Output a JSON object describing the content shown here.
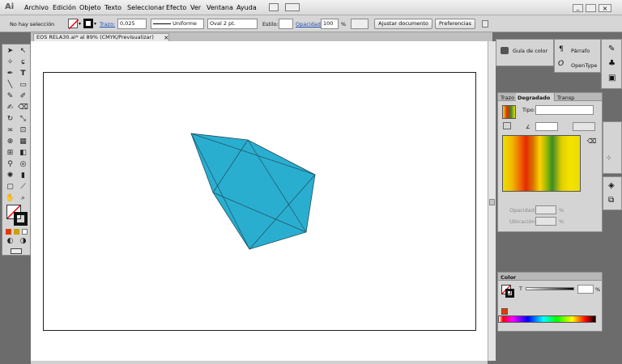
{
  "app": {
    "logo": "Ai"
  },
  "menu": [
    "Archivo",
    "Edición",
    "Objeto",
    "Texto",
    "Seleccionar",
    "Efecto",
    "Ver",
    "Ventana",
    "Ayuda"
  ],
  "control": {
    "selection": "No hay selección",
    "stroke_label": "Trazo:",
    "stroke_weight": "0,025",
    "profile": "Uniforme",
    "brush": "Oval 2 pt.",
    "style_label": "Estilo:",
    "opacity_label": "Opacidad:",
    "opacity_value": "100",
    "opacity_unit": "%",
    "fit_doc": "Ajustar documento",
    "prefs": "Preferencias"
  },
  "document": {
    "tab_title": "EOS RELA30.ai* al 89% (CMYK/Previsualizar)",
    "close": "×"
  },
  "panels": {
    "color_guide": "Guía de color",
    "paragraph": "Párrafo",
    "opentype": "OpenType",
    "gradient": {
      "tabs": [
        "Trazo",
        "Degradado",
        "Transp"
      ],
      "type_label": "Tipo:",
      "opacity_label": "Opacidad:",
      "location_label": "Ubicación:",
      "pct": "%"
    },
    "color": {
      "title": "Color",
      "t_label": "T",
      "pct": "%"
    }
  },
  "colors": {
    "shape_fill": "#2aaed0",
    "shape_stroke": "#1d4f5e",
    "accent": "#1c4fb0"
  }
}
